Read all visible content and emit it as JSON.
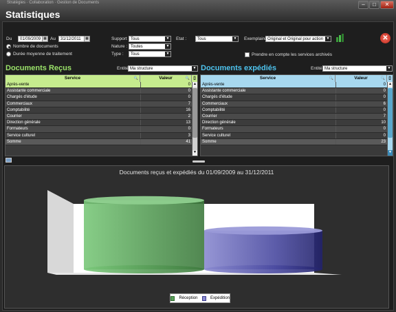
{
  "window": {
    "app_title": "Stratégies · Collaboration · Gestion de Documents",
    "heading": "Statistiques",
    "minimize": "–",
    "maximize": "□",
    "close": "✕"
  },
  "filters": {
    "du_label": "Du",
    "du_value": "01/09/2009",
    "au_label": "Au",
    "au_value": "31/12/2011",
    "radio_nombre": "Nombre de documents",
    "radio_duree": "Durée moyenne de traitement",
    "support_label": "Support",
    "support_value": "Tous",
    "nature_label": "Nature :",
    "nature_value": "Toutes",
    "type_label": "Type :",
    "type_value": "Tous",
    "etat_label": "Etat :",
    "etat_value": "Tous",
    "exemplaire_label": "Exemplaire",
    "exemplaire_value": "Original et Original pour action",
    "archives_label": "Prendre en compte les services archivés"
  },
  "recus": {
    "title": "Documents Reçus",
    "entite_label": "Entité",
    "entite_value": "Ma structure",
    "col_service": "Service",
    "col_valeur": "Valeur",
    "rows": [
      {
        "service": "Après-vente",
        "valeur": "0"
      },
      {
        "service": "Assistante commerciale",
        "valeur": "0"
      },
      {
        "service": "Chargés d'étude",
        "valeur": "0"
      },
      {
        "service": "Commerciaux",
        "valeur": "7"
      },
      {
        "service": "Comptabilité",
        "valeur": "16"
      },
      {
        "service": "Courrier",
        "valeur": "2"
      },
      {
        "service": "Direction générale",
        "valeur": "13"
      },
      {
        "service": "Formateurs",
        "valeur": "0"
      },
      {
        "service": "Service culturel",
        "valeur": "3"
      }
    ],
    "sum_label": "Somme",
    "sum_value": "41"
  },
  "expedies": {
    "title": "Documents expédiés",
    "entite_label": "Entité",
    "entite_value": "Ma structure",
    "col_service": "Service",
    "col_valeur": "Valeur",
    "rows": [
      {
        "service": "Après-vente",
        "valeur": "0"
      },
      {
        "service": "Assistante commerciale",
        "valeur": "0"
      },
      {
        "service": "Chargés d'étude",
        "valeur": "0"
      },
      {
        "service": "Commerciaux",
        "valeur": "6"
      },
      {
        "service": "Comptabilité",
        "valeur": "0"
      },
      {
        "service": "Courrier",
        "valeur": "7"
      },
      {
        "service": "Direction générale",
        "valeur": "10"
      },
      {
        "service": "Formateurs",
        "valeur": "0"
      },
      {
        "service": "Service culturel",
        "valeur": "0"
      }
    ],
    "sum_label": "Somme",
    "sum_value": "23"
  },
  "chart_data": {
    "type": "bar",
    "title": "Documents reçus et expédiés du 01/09/2009 au 31/12/2011",
    "categories": [
      ""
    ],
    "series": [
      {
        "name": "Réception",
        "values": [
          41
        ],
        "color": "#5aa05a"
      },
      {
        "name": "Expédition",
        "values": [
          23
        ],
        "color": "#5555aa"
      }
    ],
    "ylim": [
      0,
      45
    ],
    "legend": "bottom-center",
    "grid": false
  },
  "colors": {
    "recus_title": "#9be36a",
    "expedies_title": "#4ec3ee",
    "recus_header": "#c6ec8e",
    "expedies_header": "#a7d8ef"
  }
}
